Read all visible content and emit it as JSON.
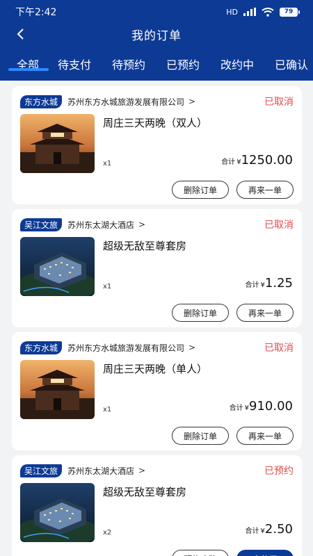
{
  "status_bar": {
    "time": "下午2:42",
    "network": "HD",
    "battery": "79"
  },
  "header": {
    "title": "我的订单"
  },
  "tabs": [
    {
      "label": "全部"
    },
    {
      "label": "待支付"
    },
    {
      "label": "待预约"
    },
    {
      "label": "已预约"
    },
    {
      "label": "改约中"
    },
    {
      "label": "已确认"
    }
  ],
  "orders": [
    {
      "brand": "东方水城",
      "merchant": "苏州东方水城旅游发展有限公司",
      "status": "已取消",
      "product": "周庄三天两晚（双人）",
      "qty": "x1",
      "total_label": "合计",
      "currency": "¥",
      "amount": "1250.00",
      "btn1": "删除订单",
      "btn2": "再来一单",
      "image": "gate-tower"
    },
    {
      "brand": "吴江文旅",
      "merchant": "苏州东太湖大酒店",
      "status": "已取消",
      "product": "超级无敌至尊套房",
      "qty": "x1",
      "total_label": "合计",
      "currency": "¥",
      "amount": "1.25",
      "btn1": "删除订单",
      "btn2": "再来一单",
      "image": "hotel-night"
    },
    {
      "brand": "东方水城",
      "merchant": "苏州东方水城旅游发展有限公司",
      "status": "已取消",
      "product": "周庄三天两晚（单人）",
      "qty": "x1",
      "total_label": "合计",
      "currency": "¥",
      "amount": "910.00",
      "btn1": "删除订单",
      "btn2": "再来一单",
      "image": "gate-tower"
    },
    {
      "brand": "吴江文旅",
      "merchant": "苏州东太湖大酒店",
      "status": "已预约",
      "product": "超级无敌至尊套房",
      "qty": "x2",
      "total_label": "合计",
      "currency": "¥",
      "amount": "2.50",
      "btn1": "预约攻略",
      "btn2": "去使用",
      "image": "hotel-night"
    }
  ],
  "colors": {
    "brand_blue": "#0d3a95",
    "status_red": "#e34b4b",
    "tab_underline": "#2d8cff"
  }
}
